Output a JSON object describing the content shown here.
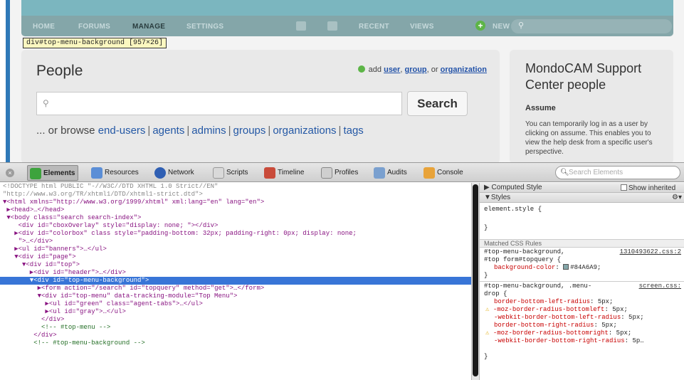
{
  "colors": {
    "menu_bg": "#84A6A9",
    "accent_blue": "#3875d7",
    "green": "#5db547"
  },
  "top_menu": {
    "items": [
      "HOME",
      "FORUMS",
      "MANAGE",
      "SETTINGS",
      "RECENT",
      "VIEWS",
      "NEW"
    ],
    "active": "MANAGE"
  },
  "inspect_tooltip": "div#top-menu-background [957×26]",
  "people": {
    "title": "People",
    "add_prefix": "add",
    "add_user": "user",
    "add_group": "group",
    "add_or": ", or",
    "add_org": "organization",
    "search_button": "Search",
    "browse_prefix": "... or browse",
    "browse_links": [
      "end-users",
      "agents",
      "admins",
      "groups",
      "organizations",
      "tags"
    ]
  },
  "sidebar": {
    "title": "MondoCAM Support Center people",
    "subtitle": "Assume",
    "text": "You can temporarily log in as a user by clicking on assume. This enables you to view the help desk from a specific user's perspective."
  },
  "devtools": {
    "tabs": [
      "Elements",
      "Resources",
      "Network",
      "Scripts",
      "Timeline",
      "Profiles",
      "Audits",
      "Console"
    ],
    "selected_tab": "Elements",
    "search_placeholder": "Search Elements",
    "dom_lines": [
      "<!DOCTYPE html PUBLIC \"-//W3C//DTD XHTML 1.0 Strict//EN\"",
      "\"http://www.w3.org/TR/xhtml1/DTD/xhtml1-strict.dtd\">",
      "▼<html xmlns=\"http://www.w3.org/1999/xhtml\" xml:lang=\"en\" lang=\"en\">",
      " ▶<head>…</head>",
      " ▼<body class=\"search search-index\">",
      "    <div id=\"cboxOverlay\" style=\"display: none; \"></div>",
      "   ▶<div id=\"colorbox\" class style=\"padding-bottom: 32px; padding-right: 0px; display: none;",
      "    \">…</div>",
      "   ▶<ul id=\"banners\">…</ul>",
      "   ▼<div id=\"page\">",
      "     ▼<div id=\"top\">",
      "       ▶<div id=\"header\">…</div>",
      "       ▼<div id=\"top-menu-background\">",
      "         ▶<form action=\"/search\" id=\"topquery\" method=\"get\">…</form>",
      "         ▼<div id=\"top-menu\" data-tracking-module=\"Top Menu\">",
      "           ▶<ul id=\"green\" class=\"agent-tabs\">…</ul>",
      "           ▶<ul id=\"gray\">…</ul>",
      "          </div>",
      "          <!-- #top-menu -->",
      "        </div>",
      "        <!-- #top-menu-background -->"
    ],
    "selected_line": 12,
    "styles": {
      "computed_header": "Computed Style",
      "show_inherited": "Show inherited",
      "styles_header": "Styles",
      "element_style": "element.style {",
      "element_style_close": "}",
      "matched_header": "Matched CSS Rules",
      "rule1_selector_a": "#top-menu-background,",
      "rule1_selector_b": "#top form#topquery {",
      "rule1_source": "1310493622.css:2",
      "rule1_prop": "background-color",
      "rule1_value": "#84A6A9;",
      "rule2_selector_a": "#top-menu-background, .menu-",
      "rule2_selector_b": "drop {",
      "rule2_source": "screen.css:",
      "rule2_decls": [
        {
          "warn": false,
          "prop": "border-bottom-left-radius",
          "value": "5px;"
        },
        {
          "warn": true,
          "prop": "-moz-border-radius-bottomleft",
          "value": "5px;"
        },
        {
          "warn": false,
          "prop": "-webkit-border-bottom-left-radius",
          "value": "5px;"
        },
        {
          "warn": false,
          "prop": "border-bottom-right-radius",
          "value": "5px;"
        },
        {
          "warn": true,
          "prop": "-moz-border-radius-bottomright",
          "value": "5px;"
        },
        {
          "warn": false,
          "prop": "-webkit-border-bottom-right-radius",
          "value": "5p…"
        }
      ],
      "close_brace": "}"
    }
  }
}
